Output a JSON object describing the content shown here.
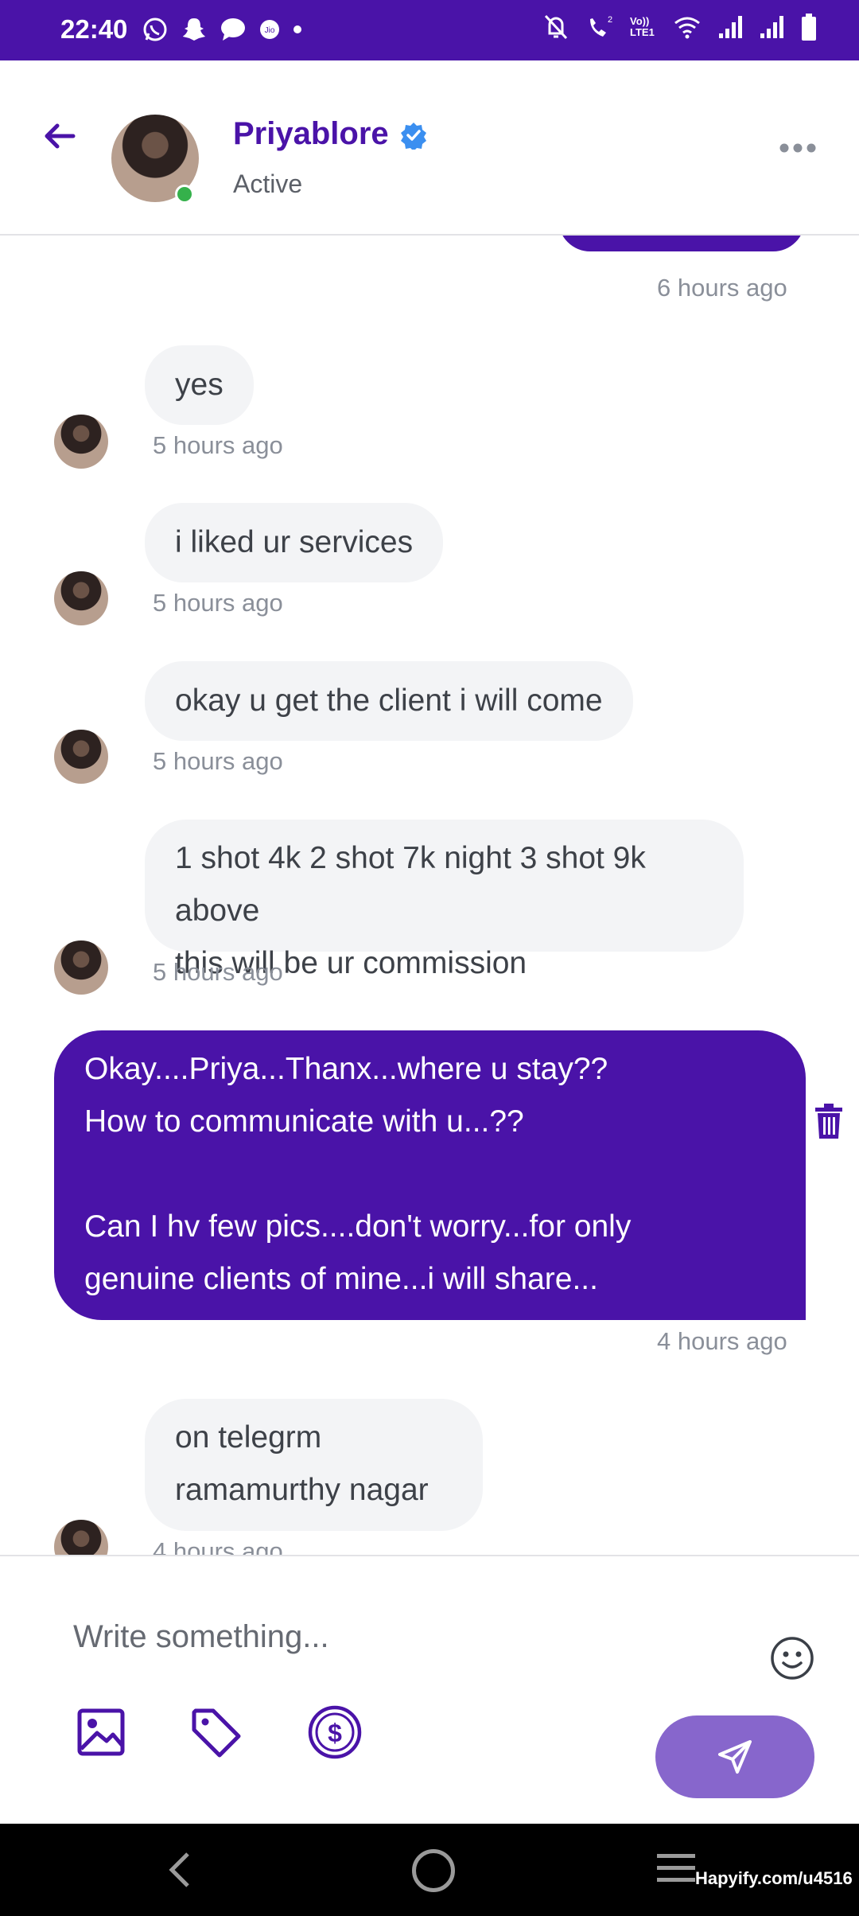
{
  "status_bar": {
    "time": "22:40",
    "lte_label": "Vo)) LTE1"
  },
  "header": {
    "name": "Priyablore",
    "status": "Active"
  },
  "messages": [
    {
      "direction": "out",
      "text": "",
      "time": "6 hours ago"
    },
    {
      "direction": "in",
      "text": "yes",
      "time": "5 hours ago"
    },
    {
      "direction": "in",
      "text": "i liked ur services",
      "time": "5 hours ago"
    },
    {
      "direction": "in",
      "text": "okay u get the client i will come",
      "time": "5 hours ago"
    },
    {
      "direction": "in",
      "lines": [
        "1 shot 4k 2 shot 7k night 3 shot 9k above",
        "this will be ur commission"
      ],
      "time": "5 hours ago"
    },
    {
      "direction": "out",
      "lines": [
        "Okay....Priya...Thanx...where u stay??",
        "How to communicate with u...??",
        "",
        "Can I hv few pics....don't worry...for only",
        "genuine clients of mine...i will share..."
      ],
      "time": "4 hours ago"
    },
    {
      "direction": "in",
      "lines": [
        "on telegrm",
        "ramamurthy nagar"
      ],
      "time": "4 hours ago"
    }
  ],
  "composer": {
    "placeholder": "Write something..."
  },
  "watermark": "Hapyify.com/u4516",
  "colors": {
    "brand": "#4a13a8",
    "send": "#8766cc",
    "online": "#35b14b",
    "verified": "#3b8ff0"
  }
}
